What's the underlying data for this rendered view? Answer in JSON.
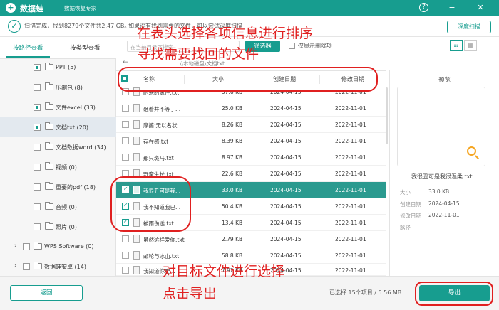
{
  "titlebar": {
    "logo": "+",
    "name": "数据蛙",
    "subtitle": "数据恢复专家",
    "help_icon": "?",
    "minimize_icon": "−",
    "close_icon": "✕"
  },
  "status": {
    "check_icon": "✓",
    "message": "扫描完成，找到8279个文件共2.47 GB。",
    "extra": "如果没有找到需要的文件，可以尝试深度扫描",
    "stop": "深度扫描"
  },
  "sidebar": {
    "tabs": [
      "按路径查看",
      "按类型查看"
    ],
    "items": [
      {
        "label": "PPT (5)"
      },
      {
        "label": "压缩包 (8)"
      },
      {
        "label": "文件excel (33)"
      },
      {
        "label": "文档txt (20)"
      },
      {
        "label": "文档数据word (34)"
      },
      {
        "label": "视频 (0)"
      },
      {
        "label": "重要的pdf (18)"
      },
      {
        "label": "音频 (0)"
      },
      {
        "label": "照片 (0)"
      },
      {
        "label": "WPS Software (0)"
      },
      {
        "label": "数据蛙安卓 (14)"
      }
    ]
  },
  "toolbar": {
    "search_placeholder": "在当前目录下搜索",
    "filter": "筛选器",
    "show_deleted": "仅显示删除项",
    "back_icon": "←",
    "path": "\\\\本地磁盘\\文档txt",
    "view_list_icon": "☷",
    "view_grid_icon": "▦"
  },
  "table": {
    "headers": {
      "name": "名称",
      "size": "大小",
      "created": "创建日期",
      "modified": "修改日期"
    },
    "rows": [
      {
        "name": "耐寒的氢仔.txt",
        "size": "57.6 KB",
        "created": "2024-04-15",
        "modified": "2022-11-01"
      },
      {
        "name": "砸着井不等于...",
        "size": "25.0 KB",
        "created": "2024-04-15",
        "modified": "2022-11-01"
      },
      {
        "name": "摩擦:无以名状...",
        "size": "8.26 KB",
        "created": "2024-04-15",
        "modified": "2022-11-01"
      },
      {
        "name": "存在感.txt",
        "size": "8.39 KB",
        "created": "2024-04-15",
        "modified": "2022-11-01"
      },
      {
        "name": "那只斑马.txt",
        "size": "8.97 KB",
        "created": "2024-04-15",
        "modified": "2022-11-01"
      },
      {
        "name": "野蛮生长.txt",
        "size": "22.6 KB",
        "created": "2024-04-15",
        "modified": "2022-11-01"
      },
      {
        "name": "我很丑可是我...",
        "size": "33.0 KB",
        "created": "2024-04-15",
        "modified": "2022-11-01"
      },
      {
        "name": "我不知道我已...",
        "size": "50.4 KB",
        "created": "2024-04-15",
        "modified": "2022-11-01"
      },
      {
        "name": "被雨伤透.txt",
        "size": "13.4 KB",
        "created": "2024-04-15",
        "modified": "2022-11-01"
      },
      {
        "name": "虽然这样爱你.txt",
        "size": "2.79 KB",
        "created": "2024-04-15",
        "modified": "2022-11-01"
      },
      {
        "name": "邮轮与冰山.txt",
        "size": "58.8 KB",
        "created": "2024-04-15",
        "modified": "2022-11-01"
      },
      {
        "name": "我知道你要...",
        "size": "7.92 KB",
        "created": "2024-04-15",
        "modified": "2022-11-01"
      }
    ]
  },
  "preview": {
    "title": "预览",
    "file_name": "我很丑可是我很温柔.txt",
    "size_label": "大小",
    "size": "33.0 KB",
    "created_label": "创建日期",
    "created": "2024-04-15",
    "modified_label": "修改日期",
    "modified": "2022-11-01",
    "path_label": "路径"
  },
  "bottom": {
    "back": "返回",
    "selected_info": "已选择 15个项目 / 5.56 MB",
    "export": "导出"
  },
  "annotations": {
    "header_hint_1": "在表头选择各项信息进行排序",
    "header_hint_2": "寻找需要找回的文件",
    "select_hint_1": "对目标文件进行选择",
    "select_hint_2": "点击导出"
  },
  "colors": {
    "accent": "#179d8f",
    "annotation": "#e02020",
    "selected_row": "#2b9a8f"
  }
}
